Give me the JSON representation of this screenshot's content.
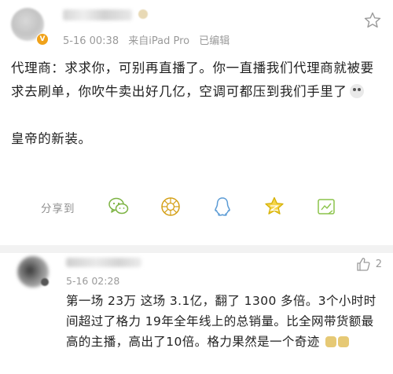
{
  "post": {
    "meta": {
      "time": "5-16 00:38",
      "source": "来自iPad Pro",
      "edited": "已编辑"
    },
    "content": {
      "paragraph1": "代理商：求求你，可别再直播了。你一直播我们代理商就被要求去刷单，你吹牛卖出好几亿，空调可都压到我们手里了",
      "paragraph2": "皇帝的新装。"
    },
    "share": {
      "label": "分享到",
      "targets": [
        "wechat-icon",
        "moments-icon",
        "qq-icon",
        "qzone-icon",
        "weibo-icon"
      ]
    }
  },
  "comment": {
    "time": "5-16 02:28",
    "likes": "2",
    "text": "第一场 23万 这场 3.1亿，翻了 1300 多倍。3个小时时间超过了格力 19年全年线上的总销量。比全网带货额最高的主播，高出了10倍。格力果然是一个奇迹"
  },
  "colors": {
    "icon_green": "#7cb342",
    "icon_teal": "#4db6ac",
    "icon_blue": "#5b9bd5",
    "icon_gold": "#d4b106",
    "text_gray": "#9a9a9a"
  }
}
